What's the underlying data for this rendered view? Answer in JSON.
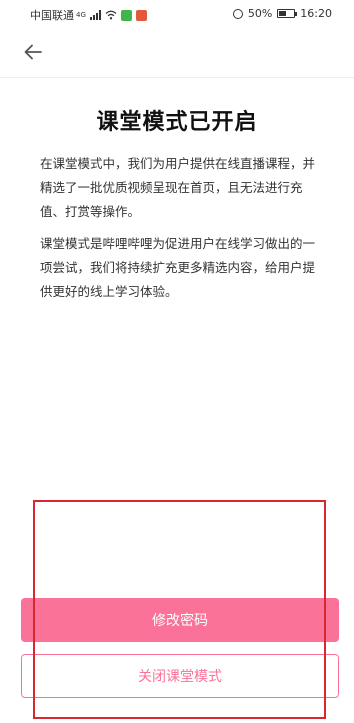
{
  "status_bar": {
    "carrier": "中国联通",
    "network_label": "4G",
    "battery_text": "50%",
    "battery_level": 0.5,
    "time": "16:20"
  },
  "nav": {
    "back_icon": "arrow-left-icon"
  },
  "content": {
    "title": "课堂模式已开启",
    "paragraph1": "在课堂模式中，我们为用户提供在线直播课程，并精选了一批优质视频呈现在首页，且无法进行充值、打赏等操作。",
    "paragraph2": "课堂模式是哔哩哔哩为促进用户在线学习做出的一项尝试，我们将持续扩充更多精选内容，给用户提供更好的线上学习体验。"
  },
  "actions": {
    "change_password_label": "修改密码",
    "close_mode_label": "关闭课堂模式"
  },
  "colors": {
    "accent": "#fb7299",
    "highlight": "#d9262f"
  }
}
